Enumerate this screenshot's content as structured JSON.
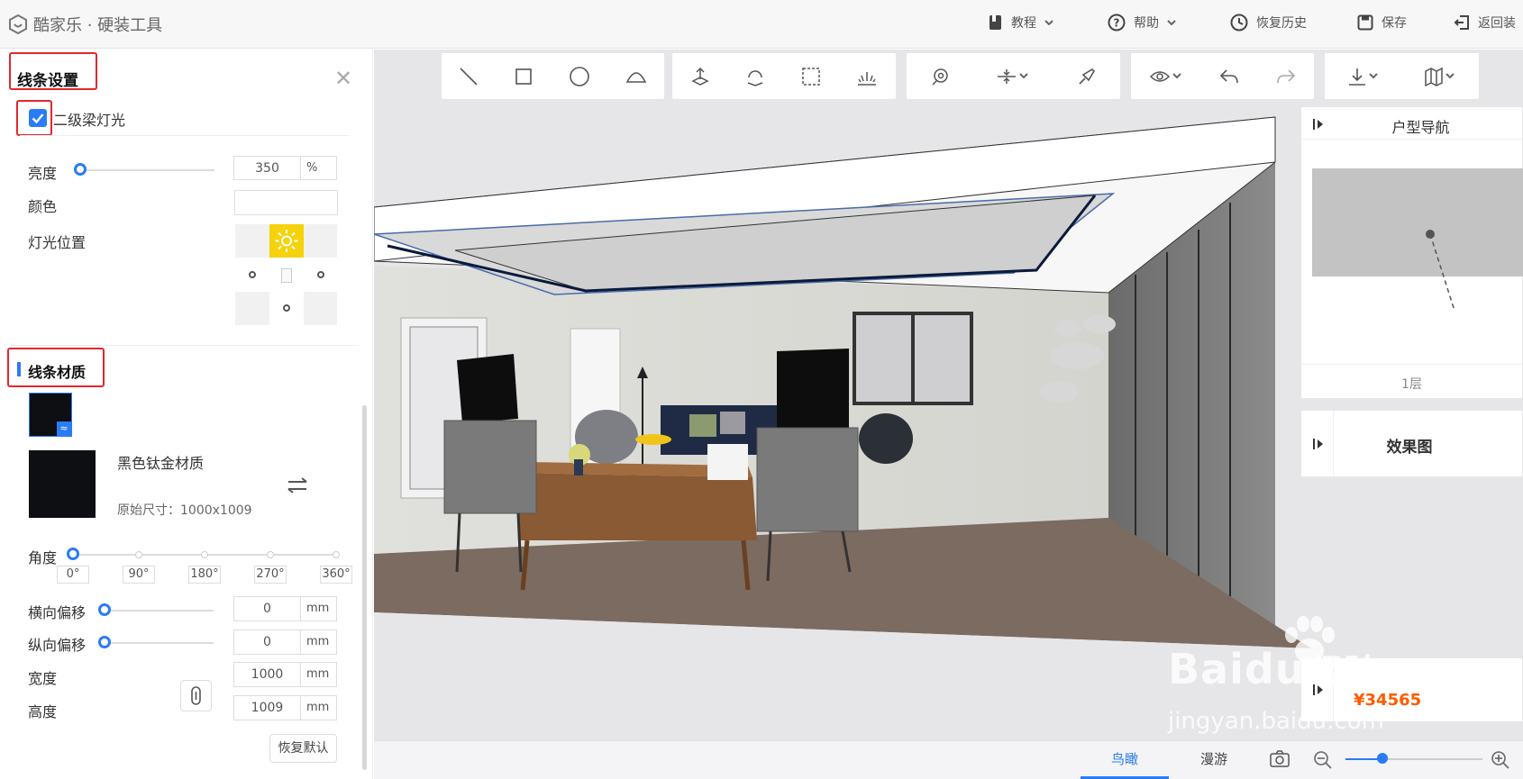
{
  "app": {
    "title": "酷家乐 · 硬装工具"
  },
  "topmenu": {
    "tutorial": "教程",
    "help": "帮助",
    "history": "恢复历史",
    "save": "保存",
    "back": "返回装"
  },
  "panel": {
    "title": "线条设置",
    "beam_light_label": "二级梁灯光",
    "beam_light_checked": true,
    "brightness_label": "亮度",
    "brightness_value": "350",
    "brightness_unit": "%",
    "brightness_level": 0.04,
    "color_label": "颜色",
    "light_pos_label": "灯光位置",
    "material_title": "线条材质",
    "material_name": "黑色钛金材质",
    "material_size": "原始尺寸：1000x1009",
    "angle_label": "角度",
    "angle_ticks": [
      "0°",
      "90°",
      "180°",
      "270°",
      "360°"
    ],
    "angle_value": 0,
    "h_offset_label": "横向偏移",
    "h_offset_value": "0",
    "v_offset_label": "纵向偏移",
    "v_offset_value": "0",
    "width_label": "宽度",
    "width_value": "1000",
    "height_label": "高度",
    "height_value": "1009",
    "unit_mm": "mm",
    "reset": "恢复默认"
  },
  "navigator": {
    "title": "户型导航",
    "floor": "1层"
  },
  "render": {
    "title": "效果图",
    "price": "¥34565"
  },
  "bottombar": {
    "tab_bird": "鸟瞰",
    "tab_roam": "漫游",
    "active_tab": "鸟瞰",
    "zoom_level": 0.27
  },
  "watermark": {
    "brand": "Baidu",
    "cn": "经验",
    "url": "jingyan.baidu.com"
  },
  "colors": {
    "accent": "#2a7bf6",
    "highlight": "#e0282e",
    "light": "#f5d20a",
    "price": "#ff5a00"
  }
}
